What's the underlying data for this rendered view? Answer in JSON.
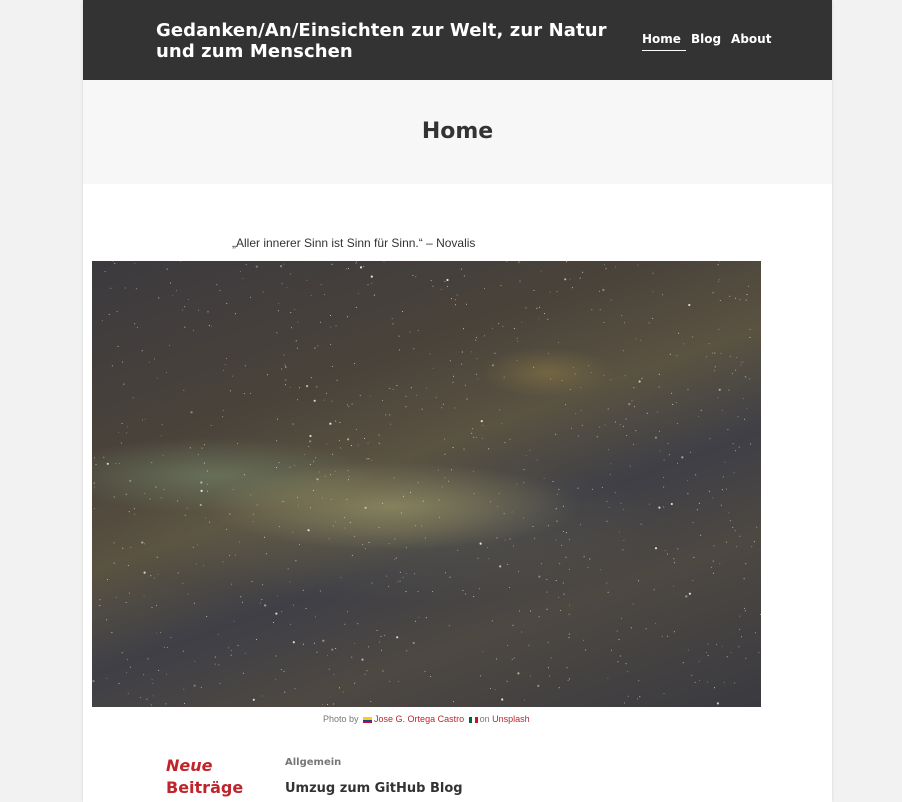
{
  "site": {
    "title": "Gedanken/An/Einsichten zur Welt, zur Natur und zum Menschen"
  },
  "nav": {
    "items": [
      {
        "label": "Home",
        "active": true
      },
      {
        "label": "Blog",
        "active": false
      },
      {
        "label": "About",
        "active": false
      }
    ]
  },
  "page": {
    "title": "Home",
    "quote": "„Aller innerer Sinn ist Sinn für Sinn.“ – Novalis"
  },
  "photo": {
    "caption_prefix": "Photo by",
    "author": "Jose G. Ortega Castro",
    "caption_on": "on",
    "source": "Unsplash"
  },
  "widget": {
    "title_word1": "Neue",
    "title_word2": "Beiträge",
    "post_category": "Allgemein",
    "post_title": "Umzug zum GitHub Blog"
  },
  "colors": {
    "header_bg": "#333333",
    "accent": "#c0242b",
    "page_bg": "#f2f2f2"
  }
}
